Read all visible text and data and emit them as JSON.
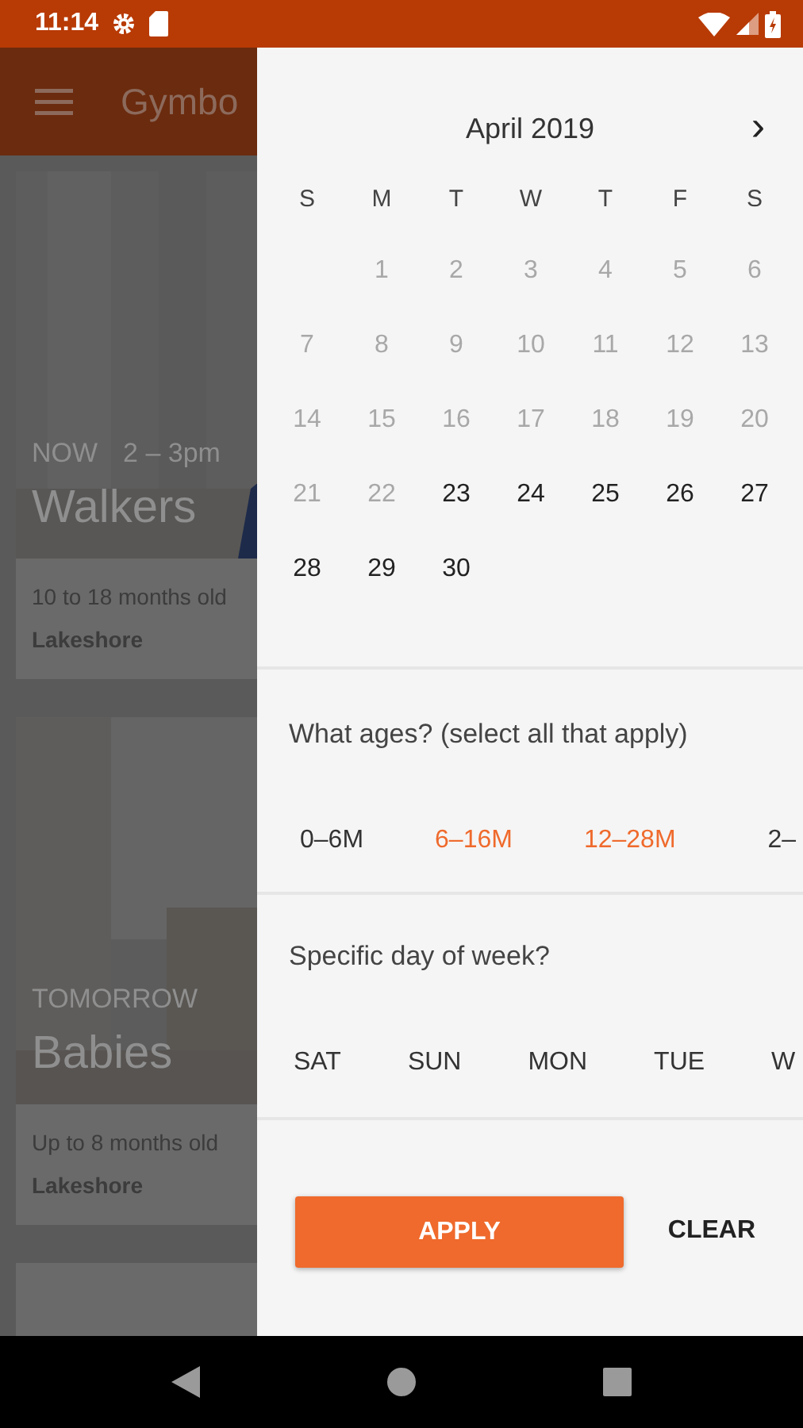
{
  "status_bar": {
    "time": "11:14"
  },
  "app_bar": {
    "title": "Gymbo"
  },
  "classes": [
    {
      "when": "NOW",
      "time": "2 – 3pm",
      "name": "Walkers",
      "ages": "10 to 18 months old",
      "location": "Lakeshore"
    },
    {
      "when": "TOMORROW",
      "name": "Babies",
      "ages": "Up to 8 months old",
      "location": "Lakeshore"
    }
  ],
  "filter_drawer": {
    "calendar": {
      "month": "April 2019",
      "next": "›",
      "weekdays": [
        "S",
        "M",
        "T",
        "W",
        "T",
        "F",
        "S"
      ],
      "weeks": [
        [
          {
            "day": "1",
            "disabled": true
          },
          {
            "day": "2",
            "disabled": true
          },
          {
            "day": "3",
            "disabled": true
          },
          {
            "day": "4",
            "disabled": true
          },
          {
            "day": "5",
            "disabled": true
          },
          {
            "day": "6",
            "disabled": true
          }
        ],
        [
          {
            "day": "7",
            "disabled": true
          },
          {
            "day": "8",
            "disabled": true
          },
          {
            "day": "9",
            "disabled": true
          },
          {
            "day": "10",
            "disabled": true
          },
          {
            "day": "11",
            "disabled": true
          },
          {
            "day": "12",
            "disabled": true
          },
          {
            "day": "13",
            "disabled": true
          }
        ],
        [
          {
            "day": "14",
            "disabled": true
          },
          {
            "day": "15",
            "disabled": true
          },
          {
            "day": "16",
            "disabled": true
          },
          {
            "day": "17",
            "disabled": true
          },
          {
            "day": "18",
            "disabled": true
          },
          {
            "day": "19",
            "disabled": true
          },
          {
            "day": "20",
            "disabled": true
          }
        ],
        [
          {
            "day": "21",
            "disabled": true
          },
          {
            "day": "22",
            "disabled": true
          },
          {
            "day": "23",
            "disabled": false
          },
          {
            "day": "24",
            "disabled": false
          },
          {
            "day": "25",
            "disabled": false
          },
          {
            "day": "26",
            "disabled": false
          },
          {
            "day": "27",
            "disabled": false
          }
        ],
        [
          {
            "day": "28",
            "disabled": false
          },
          {
            "day": "29",
            "disabled": false
          },
          {
            "day": "30",
            "disabled": false
          }
        ]
      ]
    },
    "ages": {
      "title": "What ages? (select all that apply)",
      "options": [
        {
          "label": "0–6M",
          "selected": false
        },
        {
          "label": "6–16M",
          "selected": true
        },
        {
          "label": "12–28M",
          "selected": true
        },
        {
          "label": "2–",
          "selected": false
        }
      ]
    },
    "days": {
      "title": "Specific day of week?",
      "options": [
        {
          "label": "SAT",
          "selected": false
        },
        {
          "label": "SUN",
          "selected": false
        },
        {
          "label": "MON",
          "selected": false
        },
        {
          "label": "TUE",
          "selected": false
        },
        {
          "label": "W",
          "selected": false
        }
      ]
    },
    "buttons": [
      {
        "label": "APPLY",
        "kind": "primary"
      },
      {
        "label": "CLEAR",
        "kind": "text"
      }
    ]
  }
}
